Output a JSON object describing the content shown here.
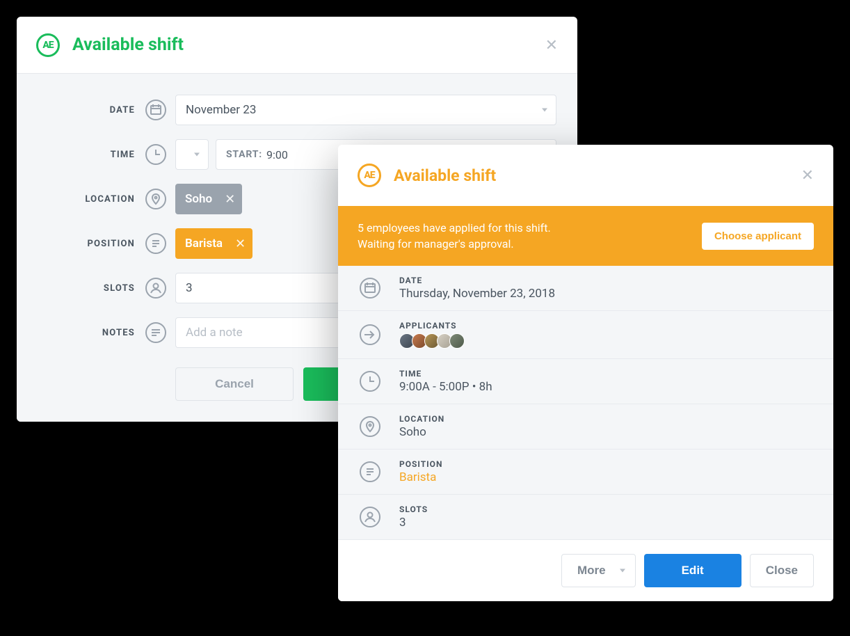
{
  "modal1": {
    "title": "Available shift",
    "date_label": "DATE",
    "date_value": "November 23",
    "time_label": "TIME",
    "time_start_label": "START:",
    "time_start_value": "9:00",
    "location_label": "LOCATION",
    "location_chip": "Soho",
    "position_label": "POSITION",
    "position_chip": "Barista",
    "slots_label": "SLOTS",
    "slots_value": "3",
    "notes_label": "NOTES",
    "notes_placeholder": "Add a note",
    "cancel": "Cancel"
  },
  "modal2": {
    "title": "Available shift",
    "banner_line1": "5 employees have applied for this shift.",
    "banner_line2": "Waiting for manager's approval.",
    "banner_btn": "Choose applicant",
    "date_label": "DATE",
    "date_value": "Thursday, November 23, 2018",
    "applicants_label": "APPLICANTS",
    "time_label": "TIME",
    "time_value": "9:00A - 5:00P • 8h",
    "location_label": "LOCATION",
    "location_value": "Soho",
    "position_label": "POSITION",
    "position_value": "Barista",
    "slots_label": "SLOTS",
    "slots_value": "3",
    "more": "More",
    "edit": "Edit",
    "close": "Close"
  }
}
